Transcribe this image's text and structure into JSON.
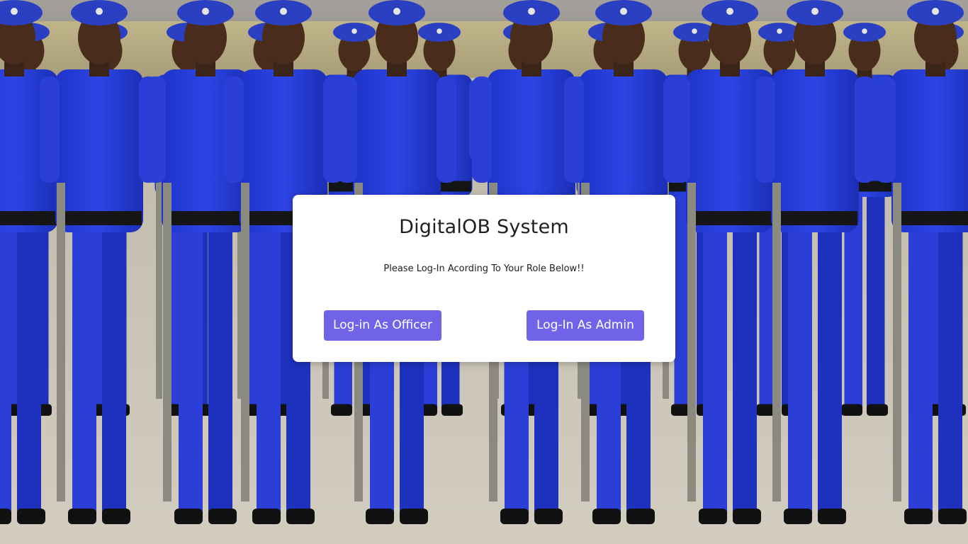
{
  "background": {
    "description_icon": "parade-photo",
    "uniform_color": "#2b3fd8",
    "beret_color": "#2a3fc2"
  },
  "login_card": {
    "title": "DigitalOB System",
    "subtitle": "Please Log-In Acording To Your Role Below!!",
    "officer_button_label": "Log-in As Officer",
    "admin_button_label": "Log-In As Admin",
    "button_color": "#7163e8"
  }
}
